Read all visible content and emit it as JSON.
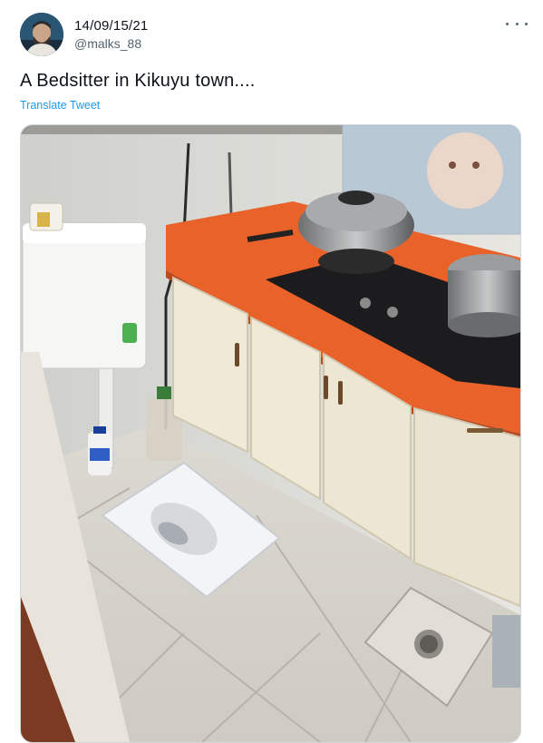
{
  "tweet": {
    "author_name": "14/09/15/21",
    "author_handle": "@malks_88",
    "text": "A Bedsitter in Kikuyu town....",
    "translate_label": "Translate Tweet"
  },
  "icons": {
    "more": "more-options-icon",
    "avatar": "user-avatar"
  },
  "colors": {
    "link": "#1d9bf0",
    "secondary_text": "#536471",
    "countertop": "#e8622a",
    "cabinet": "#efe9d6"
  }
}
